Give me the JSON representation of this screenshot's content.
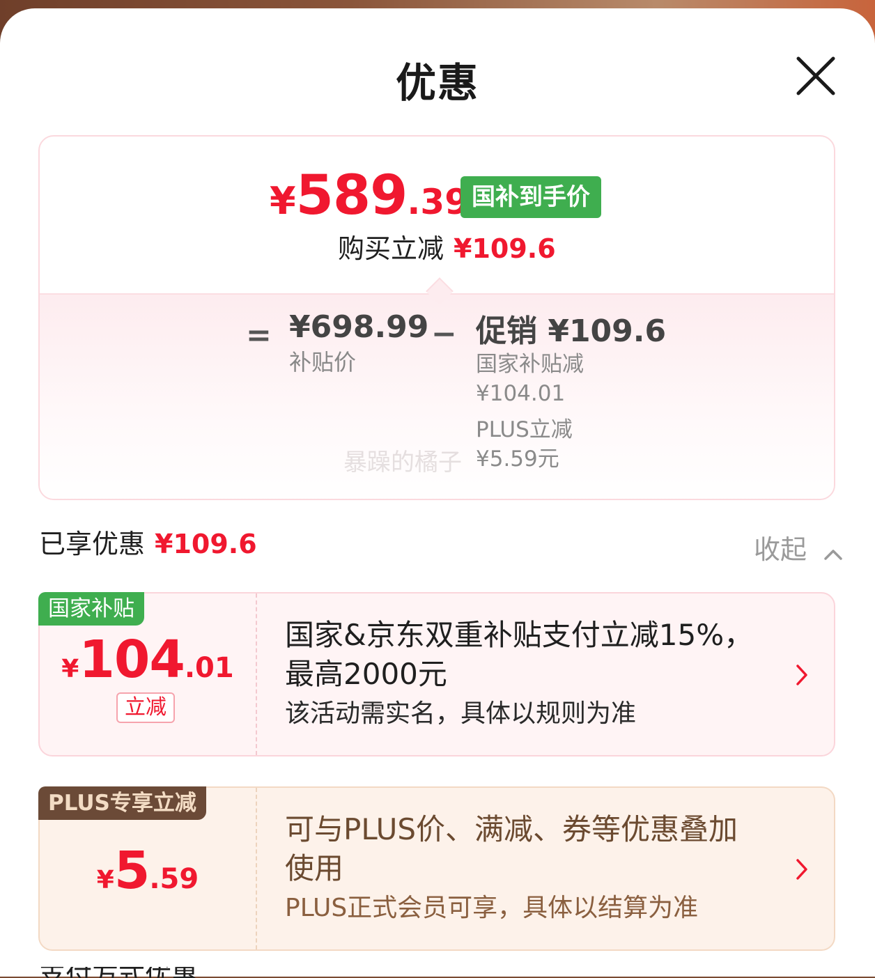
{
  "sheet": {
    "title": "优惠"
  },
  "summary": {
    "final_price": {
      "yen": "¥",
      "integer": "589",
      "decimal": ".39"
    },
    "final_tag": "国补到手价",
    "reduce_label": "购买立减",
    "reduce_amount": "¥109.6",
    "calc": {
      "eq": "=",
      "minus": "−",
      "base_amount": "¥698.99",
      "base_label": "补贴价",
      "promo_label": "促销",
      "promo_amount": "¥109.6",
      "national_label": "国家补贴减",
      "national_amount": "¥104.01",
      "plus_label": "PLUS立减",
      "plus_amount": "¥5.59元"
    },
    "watermark": "暴躁的橘子"
  },
  "enjoyed": {
    "label": "已享优惠",
    "amount": "¥109.6",
    "collapse_label": "收起"
  },
  "coupons": [
    {
      "badge": "国家补贴",
      "amount_yen": "¥",
      "amount_int": "104",
      "amount_dec": ".01",
      "tag": "立减",
      "title": "国家&京东双重补贴支付立减15%，最高2000元",
      "subtitle": "该活动需实名，具体以规则为准"
    },
    {
      "badge": "PLUS专享立减",
      "amount_yen": "¥",
      "amount_int": "5",
      "amount_dec": ".59",
      "title": "可与PLUS价、满减、券等优惠叠加使用",
      "subtitle": "PLUS正式会员可享，具体以结算为准"
    }
  ],
  "next_section_peek": "支付方式优惠",
  "colors": {
    "accent_red": "#f0182f",
    "green_tag": "#3fae4f",
    "plus_brown": "#6b4a37"
  },
  "icons": {
    "close": "close-icon",
    "collapse": "chevron-up-icon",
    "coupon_arrow": "chevron-right-icon"
  }
}
